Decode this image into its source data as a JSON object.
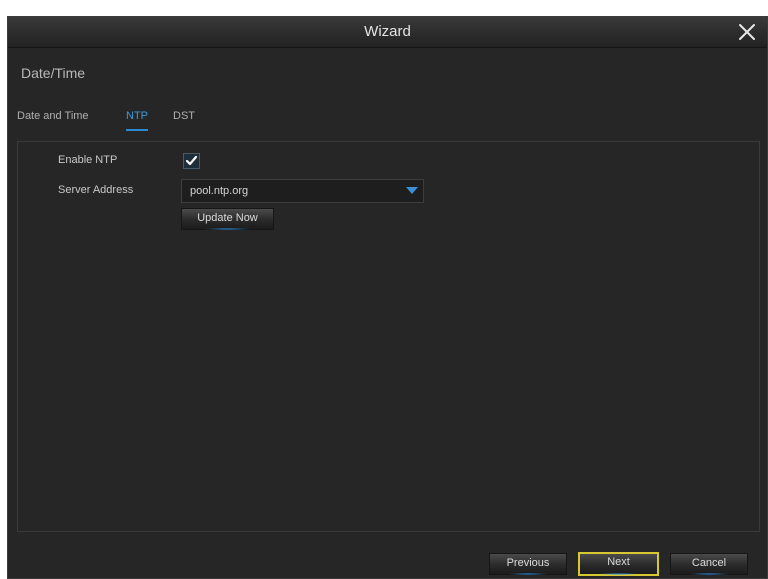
{
  "window": {
    "title": "Wizard"
  },
  "section_title": "Date/Time",
  "tabs": [
    {
      "label": "Date and Time",
      "active": false
    },
    {
      "label": "NTP",
      "active": true
    },
    {
      "label": "DST",
      "active": false
    }
  ],
  "ntp": {
    "enable_label": "Enable NTP",
    "enabled": true,
    "server_label": "Server Address",
    "server_value": "pool.ntp.org",
    "update_button": "Update Now"
  },
  "footer": {
    "previous": "Previous",
    "next": "Next",
    "cancel": "Cancel"
  },
  "colors": {
    "accent": "#2d8ad0",
    "focus": "#d8c830",
    "background": "#262626"
  }
}
